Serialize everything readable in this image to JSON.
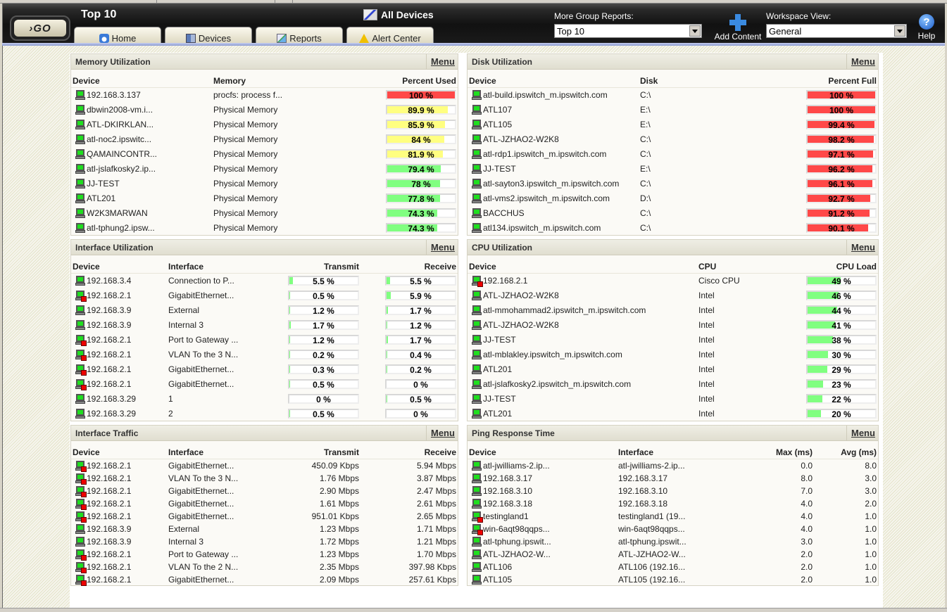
{
  "header": {
    "go_label": "GO",
    "page_title": "Top 10",
    "group_name": "All Devices",
    "tabs": [
      {
        "label": "Home",
        "icon": "home-icon"
      },
      {
        "label": "Devices",
        "icon": "devices-icon"
      },
      {
        "label": "Reports",
        "icon": "reports-icon"
      },
      {
        "label": "Alert Center",
        "icon": "alert-icon"
      }
    ],
    "more_reports_label": "More Group Reports:",
    "more_reports_value": "Top 10",
    "add_content_label": "Add Content",
    "workspace_view_label": "Workspace View:",
    "workspace_view_value": "General",
    "help_label": "Help"
  },
  "colors": {
    "red": "#ff4848",
    "yellow": "#ffff80",
    "green": "#80ff80"
  },
  "memory": {
    "title": "Memory Utilization",
    "menu": "Menu",
    "columns": [
      "Device",
      "Memory",
      "Percent Used"
    ],
    "rows": [
      {
        "device": "192.168.3.137",
        "down": false,
        "memory": "procfs: process f...",
        "pct": 100,
        "label": "100 %",
        "color": "red"
      },
      {
        "device": "dbwin2008-vm.i...",
        "down": false,
        "memory": "Physical Memory",
        "pct": 89.9,
        "label": "89.9 %",
        "color": "yellow"
      },
      {
        "device": "ATL-DKIRKLAN...",
        "down": false,
        "memory": "Physical Memory",
        "pct": 85.9,
        "label": "85.9 %",
        "color": "yellow"
      },
      {
        "device": "atl-noc2.ipswitc...",
        "down": false,
        "memory": "Physical Memory",
        "pct": 84,
        "label": "84 %",
        "color": "yellow"
      },
      {
        "device": "QAMAINCONTR...",
        "down": false,
        "memory": "Physical Memory",
        "pct": 81.9,
        "label": "81.9 %",
        "color": "yellow"
      },
      {
        "device": "atl-jslafkosky2.ip...",
        "down": false,
        "memory": "Physical Memory",
        "pct": 79.4,
        "label": "79.4 %",
        "color": "green"
      },
      {
        "device": "JJ-TEST",
        "down": false,
        "memory": "Physical Memory",
        "pct": 78,
        "label": "78 %",
        "color": "green"
      },
      {
        "device": "ATL201",
        "down": false,
        "memory": "Physical Memory",
        "pct": 77.8,
        "label": "77.8 %",
        "color": "green"
      },
      {
        "device": "W2K3MARWAN",
        "down": false,
        "memory": "Physical Memory",
        "pct": 74.3,
        "label": "74.3 %",
        "color": "green"
      },
      {
        "device": "atl-tphung2.ipsw...",
        "down": false,
        "memory": "Physical Memory",
        "pct": 74.3,
        "label": "74.3 %",
        "color": "green"
      }
    ]
  },
  "disk": {
    "title": "Disk Utilization",
    "menu": "Menu",
    "columns": [
      "Device",
      "Disk",
      "Percent Full"
    ],
    "rows": [
      {
        "device": "atl-build.ipswitch_m.ipswitch.com",
        "down": false,
        "disk": "C:\\",
        "pct": 100,
        "label": "100 %",
        "color": "red"
      },
      {
        "device": "ATL107",
        "down": false,
        "disk": "E:\\",
        "pct": 100,
        "label": "100 %",
        "color": "red"
      },
      {
        "device": "ATL105",
        "down": false,
        "disk": "E:\\",
        "pct": 99.4,
        "label": "99.4 %",
        "color": "red"
      },
      {
        "device": "ATL-JZHAO2-W2K8",
        "down": false,
        "disk": "C:\\",
        "pct": 98.2,
        "label": "98.2 %",
        "color": "red"
      },
      {
        "device": "atl-rdp1.ipswitch_m.ipswitch.com",
        "down": false,
        "disk": "C:\\",
        "pct": 97.1,
        "label": "97.1 %",
        "color": "red"
      },
      {
        "device": "JJ-TEST",
        "down": false,
        "disk": "E:\\",
        "pct": 96.2,
        "label": "96.2 %",
        "color": "red"
      },
      {
        "device": "atl-sayton3.ipswitch_m.ipswitch.com",
        "down": false,
        "disk": "C:\\",
        "pct": 96.1,
        "label": "96.1 %",
        "color": "red"
      },
      {
        "device": "atl-vms2.ipswitch_m.ipswitch.com",
        "down": false,
        "disk": "D:\\",
        "pct": 92.7,
        "label": "92.7 %",
        "color": "red"
      },
      {
        "device": "BACCHUS",
        "down": false,
        "disk": "C:\\",
        "pct": 91.2,
        "label": "91.2 %",
        "color": "red"
      },
      {
        "device": "atl134.ipswitch_m.ipswitch.com",
        "down": false,
        "disk": "C:\\",
        "pct": 90.1,
        "label": "90.1 %",
        "color": "red"
      }
    ]
  },
  "iface_util": {
    "title": "Interface Utilization",
    "menu": "Menu",
    "columns": [
      "Device",
      "Interface",
      "Transmit",
      "Receive"
    ],
    "rows": [
      {
        "device": "192.168.3.4",
        "down": false,
        "iface": "Connection to P...",
        "tx": 5.5,
        "tx_label": "5.5 %",
        "rx": 5.5,
        "rx_label": "5.5 %"
      },
      {
        "device": "192.168.2.1",
        "down": true,
        "iface": "GigabitEthernet...",
        "tx": 0.5,
        "tx_label": "0.5 %",
        "rx": 5.9,
        "rx_label": "5.9 %"
      },
      {
        "device": "192.168.3.9",
        "down": false,
        "iface": "External",
        "tx": 1.2,
        "tx_label": "1.2 %",
        "rx": 1.7,
        "rx_label": "1.7 %"
      },
      {
        "device": "192.168.3.9",
        "down": false,
        "iface": "Internal 3",
        "tx": 1.7,
        "tx_label": "1.7 %",
        "rx": 1.2,
        "rx_label": "1.2 %"
      },
      {
        "device": "192.168.2.1",
        "down": true,
        "iface": "Port to Gateway ...",
        "tx": 1.2,
        "tx_label": "1.2 %",
        "rx": 1.7,
        "rx_label": "1.7 %"
      },
      {
        "device": "192.168.2.1",
        "down": true,
        "iface": "VLAN To the 3 N...",
        "tx": 0.2,
        "tx_label": "0.2 %",
        "rx": 0.4,
        "rx_label": "0.4 %"
      },
      {
        "device": "192.168.2.1",
        "down": true,
        "iface": "GigabitEthernet...",
        "tx": 0.3,
        "tx_label": "0.3 %",
        "rx": 0.2,
        "rx_label": "0.2 %"
      },
      {
        "device": "192.168.2.1",
        "down": true,
        "iface": "GigabitEthernet...",
        "tx": 0.5,
        "tx_label": "0.5 %",
        "rx": 0,
        "rx_label": "0 %"
      },
      {
        "device": "192.168.3.29",
        "down": false,
        "iface": "1",
        "tx": 0,
        "tx_label": "0 %",
        "rx": 0.5,
        "rx_label": "0.5 %"
      },
      {
        "device": "192.168.3.29",
        "down": false,
        "iface": "2",
        "tx": 0.5,
        "tx_label": "0.5 %",
        "rx": 0,
        "rx_label": "0 %"
      }
    ]
  },
  "cpu": {
    "title": "CPU Utilization",
    "menu": "Menu",
    "columns": [
      "Device",
      "CPU",
      "CPU Load"
    ],
    "rows": [
      {
        "device": "192.168.2.1",
        "down": true,
        "cpu": "Cisco CPU",
        "pct": 49,
        "label": "49 %"
      },
      {
        "device": "ATL-JZHAO2-W2K8",
        "down": false,
        "cpu": "Intel",
        "pct": 46,
        "label": "46 %"
      },
      {
        "device": "atl-mmohammad2.ipswitch_m.ipswitch.com",
        "down": false,
        "cpu": "Intel",
        "pct": 44,
        "label": "44 %"
      },
      {
        "device": "ATL-JZHAO2-W2K8",
        "down": false,
        "cpu": "Intel",
        "pct": 41,
        "label": "41 %"
      },
      {
        "device": "JJ-TEST",
        "down": false,
        "cpu": "Intel",
        "pct": 38,
        "label": "38 %"
      },
      {
        "device": "atl-mblakley.ipswitch_m.ipswitch.com",
        "down": false,
        "cpu": "Intel",
        "pct": 30,
        "label": "30 %"
      },
      {
        "device": "ATL201",
        "down": false,
        "cpu": "Intel",
        "pct": 29,
        "label": "29 %"
      },
      {
        "device": "atl-jslafkosky2.ipswitch_m.ipswitch.com",
        "down": false,
        "cpu": "Intel",
        "pct": 23,
        "label": "23 %"
      },
      {
        "device": "JJ-TEST",
        "down": false,
        "cpu": "Intel",
        "pct": 22,
        "label": "22 %"
      },
      {
        "device": "ATL201",
        "down": false,
        "cpu": "Intel",
        "pct": 20,
        "label": "20 %"
      }
    ]
  },
  "iface_traffic": {
    "title": "Interface Traffic",
    "menu": "Menu",
    "columns": [
      "Device",
      "Interface",
      "Transmit",
      "Receive"
    ],
    "rows": [
      {
        "device": "192.168.2.1",
        "down": true,
        "iface": "GigabitEthernet...",
        "tx": "450.09 Kbps",
        "rx": "5.94 Mbps"
      },
      {
        "device": "192.168.2.1",
        "down": true,
        "iface": "VLAN To the 3 N...",
        "tx": "1.76 Mbps",
        "rx": "3.87 Mbps"
      },
      {
        "device": "192.168.2.1",
        "down": true,
        "iface": "GigabitEthernet...",
        "tx": "2.90 Mbps",
        "rx": "2.47 Mbps"
      },
      {
        "device": "192.168.2.1",
        "down": true,
        "iface": "GigabitEthernet...",
        "tx": "1.61 Mbps",
        "rx": "2.61 Mbps"
      },
      {
        "device": "192.168.2.1",
        "down": true,
        "iface": "GigabitEthernet...",
        "tx": "951.01 Kbps",
        "rx": "2.65 Mbps"
      },
      {
        "device": "192.168.3.9",
        "down": false,
        "iface": "External",
        "tx": "1.23 Mbps",
        "rx": "1.71 Mbps"
      },
      {
        "device": "192.168.3.9",
        "down": false,
        "iface": "Internal 3",
        "tx": "1.72 Mbps",
        "rx": "1.21 Mbps"
      },
      {
        "device": "192.168.2.1",
        "down": true,
        "iface": "Port to Gateway ...",
        "tx": "1.23 Mbps",
        "rx": "1.70 Mbps"
      },
      {
        "device": "192.168.2.1",
        "down": true,
        "iface": "VLAN To the 2 N...",
        "tx": "2.35 Mbps",
        "rx": "397.98 Kbps"
      },
      {
        "device": "192.168.2.1",
        "down": true,
        "iface": "GigabitEthernet...",
        "tx": "2.09 Mbps",
        "rx": "257.61 Kbps"
      }
    ]
  },
  "ping": {
    "title": "Ping Response Time",
    "menu": "Menu",
    "columns": [
      "Device",
      "Interface",
      "Max (ms)",
      "Avg (ms)"
    ],
    "rows": [
      {
        "device": "atl-jwilliams-2.ip...",
        "down": false,
        "iface": "atl-jwilliams-2.ip...",
        "max": "0.0",
        "avg": "8.0"
      },
      {
        "device": "192.168.3.17",
        "down": false,
        "iface": "192.168.3.17",
        "max": "8.0",
        "avg": "3.0"
      },
      {
        "device": "192.168.3.10",
        "down": false,
        "iface": "192.168.3.10",
        "max": "7.0",
        "avg": "3.0"
      },
      {
        "device": "192.168.3.18",
        "down": false,
        "iface": "192.168.3.18",
        "max": "4.0",
        "avg": "2.0"
      },
      {
        "device": "testingland1",
        "down": true,
        "iface": "testingland1 (19...",
        "max": "4.0",
        "avg": "1.0"
      },
      {
        "device": "win-6aqt98qqps...",
        "down": true,
        "iface": "win-6aqt98qqps...",
        "max": "4.0",
        "avg": "1.0"
      },
      {
        "device": "atl-tphung.ipswit...",
        "down": false,
        "iface": "atl-tphung.ipswit...",
        "max": "3.0",
        "avg": "1.0"
      },
      {
        "device": "ATL-JZHAO2-W...",
        "down": false,
        "iface": "ATL-JZHAO2-W...",
        "max": "2.0",
        "avg": "1.0"
      },
      {
        "device": "ATL106",
        "down": false,
        "iface": "ATL106 (192.16...",
        "max": "2.0",
        "avg": "1.0"
      },
      {
        "device": "ATL105",
        "down": false,
        "iface": "ATL105 (192.16...",
        "max": "2.0",
        "avg": "1.0"
      }
    ]
  }
}
